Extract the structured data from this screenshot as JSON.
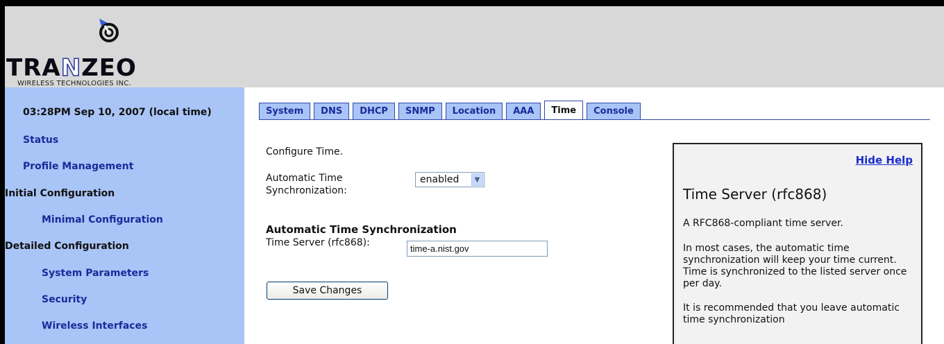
{
  "brand": {
    "name_part1": "TRA",
    "name_part2": "N",
    "name_part3": "ZEO",
    "subtitle": "WIRELESS TECHNOLOGIES INC."
  },
  "sidebar": {
    "datetime": "03:28PM Sep 10, 2007 (local time)",
    "items": [
      {
        "label": "Status",
        "type": "link"
      },
      {
        "label": "Profile Management",
        "type": "link"
      },
      {
        "label": "Initial Configuration",
        "type": "heading"
      },
      {
        "label": "Minimal Configuration",
        "type": "link"
      },
      {
        "label": "Detailed Configuration",
        "type": "heading"
      },
      {
        "label": "System Parameters",
        "type": "link"
      },
      {
        "label": "Security",
        "type": "link"
      },
      {
        "label": "Wireless Interfaces",
        "type": "link"
      }
    ]
  },
  "tabs": [
    {
      "label": "System",
      "active": false
    },
    {
      "label": "DNS",
      "active": false
    },
    {
      "label": "DHCP",
      "active": false
    },
    {
      "label": "SNMP",
      "active": false
    },
    {
      "label": "Location",
      "active": false
    },
    {
      "label": "AAA",
      "active": false
    },
    {
      "label": "Time",
      "active": true
    },
    {
      "label": "Console",
      "active": false
    }
  ],
  "form": {
    "intro": "Configure Time.",
    "auto_sync_label_line1": "Automatic Time",
    "auto_sync_label_line2": "Synchronization:",
    "auto_sync_value": "enabled",
    "section_heading": "Automatic Time Synchronization",
    "server_label": "Time Server (rfc868):",
    "server_value": "time-a.nist.gov",
    "save_label": "Save Changes"
  },
  "help": {
    "hide_label": "Hide Help",
    "title": "Time Server (rfc868)",
    "p1": "A RFC868-compliant time server.",
    "p2": "In most cases, the automatic time synchronization will keep your time current. Time is synchronized to the listed server once per day.",
    "p3": "It is recommended that you leave automatic time synchronization"
  },
  "colors": {
    "sidebar_bg": "#a9c4f6",
    "link": "#1a2a9a",
    "header_bg": "#d8d8d8"
  }
}
